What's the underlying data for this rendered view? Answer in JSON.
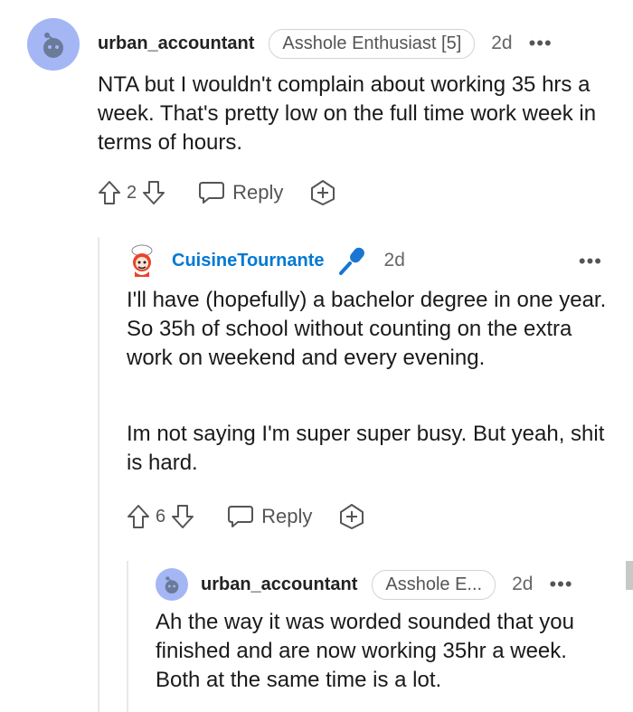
{
  "comments": [
    {
      "username": "urban_accountant",
      "flair": "Asshole Enthusiast [5]",
      "time": "2d",
      "more": "•••",
      "body": [
        "NTA but I wouldn't complain about working 35 hrs a week. That's pretty low on the full time work week in terms of hours."
      ],
      "votes": "2",
      "reply_label": "Reply"
    },
    {
      "username": "CuisineTournante",
      "time": "2d",
      "more": "•••",
      "body": [
        "I'll have (hopefully) a bachelor degree in one year. So 35h of school without counting on the extra work on weekend and every evening.",
        "Im not saying I'm super super busy. But yeah, shit is hard."
      ],
      "votes": "6",
      "reply_label": "Reply"
    },
    {
      "username": "urban_accountant",
      "flair": "Asshole E...",
      "time": "2d",
      "more": "•••",
      "body": [
        "Ah the way it was worded sounded that you finished and are now working 35hr a week. Both at the same time is a lot."
      ]
    }
  ],
  "colors": {
    "username_op": "#0079d3",
    "avatar_bg": "#a4b6f4",
    "mic": "#1976d2"
  },
  "icons": [
    "reddit-snoo-icon",
    "upvote-icon",
    "downvote-icon",
    "reply-bubble-icon",
    "award-plus-icon",
    "microphone-icon",
    "chef-avatar-icon"
  ]
}
